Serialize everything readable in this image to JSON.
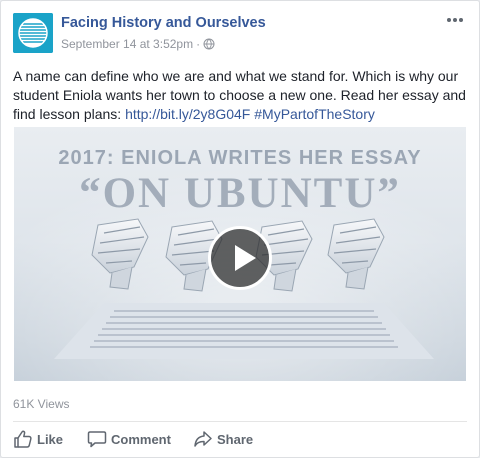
{
  "post": {
    "page_name": "Facing History and Ourselves",
    "timestamp": "September 14 at 3:52pm",
    "separator": "·",
    "text_main": "A name can define who we are and what we stand for. Which is why our student Eniola wants her town to choose a new one. Read her essay and find lesson plans: ",
    "link": "http://bit.ly/2y8G04F",
    "hashtag": "#MyPartofTheStory"
  },
  "video": {
    "headline": "2017: ENIOLA WRITES HER ESSAY",
    "title": "“ON UBUNTU”"
  },
  "stats": {
    "views": "61K Views"
  },
  "actions": {
    "like": "Like",
    "comment": "Comment",
    "share": "Share"
  },
  "colors": {
    "link": "#365899",
    "meta": "#90949c",
    "avatar": "#1aa3c8",
    "action_text": "#606770"
  },
  "icons": [
    "globe-icon",
    "more-options-icon",
    "play-icon",
    "like-icon",
    "comment-icon",
    "share-icon"
  ]
}
